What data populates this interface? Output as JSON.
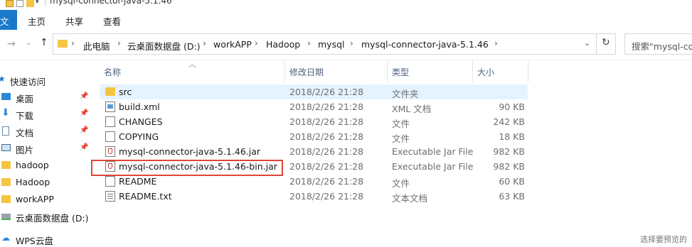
{
  "window": {
    "title": "mysql-connector-java-5.1.46"
  },
  "ribbon": {
    "tabs": [
      "文件",
      "主页",
      "共享",
      "查看"
    ]
  },
  "address": {
    "crumbs": [
      "此电脑",
      "云桌面数据盘 (D:)",
      "workAPP",
      "Hadoop",
      "mysql",
      "mysql-connector-java-5.1.46"
    ],
    "search_placeholder": "搜索\"mysql-con"
  },
  "sidebar": {
    "items": [
      {
        "label": "快速访问",
        "icon": "star-icon"
      },
      {
        "label": "桌面",
        "icon": "desktop-icon",
        "pinned": true
      },
      {
        "label": "下载",
        "icon": "download-icon",
        "pinned": true
      },
      {
        "label": "文档",
        "icon": "document-icon",
        "pinned": true
      },
      {
        "label": "图片",
        "icon": "picture-icon",
        "pinned": true
      },
      {
        "label": "hadoop",
        "icon": "folder-icon"
      },
      {
        "label": "Hadoop",
        "icon": "folder-icon"
      },
      {
        "label": "workAPP",
        "icon": "folder-icon"
      },
      {
        "label": "云桌面数据盘 (D:)",
        "icon": "drive-icon"
      },
      {
        "label": "WPS云盘",
        "icon": "cloud-icon"
      }
    ]
  },
  "columns": [
    "名称",
    "修改日期",
    "类型",
    "大小"
  ],
  "files": [
    {
      "name": "src",
      "date": "2018/2/26 21:28",
      "type": "文件夹",
      "size": "",
      "icon": "folder-icon",
      "selected": true
    },
    {
      "name": "build.xml",
      "date": "2018/2/26 21:28",
      "type": "XML 文档",
      "size": "90 KB",
      "icon": "xml-file-icon"
    },
    {
      "name": "CHANGES",
      "date": "2018/2/26 21:28",
      "type": "文件",
      "size": "242 KB",
      "icon": "file-icon"
    },
    {
      "name": "COPYING",
      "date": "2018/2/26 21:28",
      "type": "文件",
      "size": "18 KB",
      "icon": "file-icon"
    },
    {
      "name": "mysql-connector-java-5.1.46.jar",
      "date": "2018/2/26 21:28",
      "type": "Executable Jar File",
      "size": "982 KB",
      "icon": "jar-file-icon"
    },
    {
      "name": "mysql-connector-java-5.1.46-bin.jar",
      "date": "2018/2/26 21:28",
      "type": "Executable Jar File",
      "size": "982 KB",
      "icon": "jar-file-icon"
    },
    {
      "name": "README",
      "date": "2018/2/26 21:28",
      "type": "文件",
      "size": "60 KB",
      "icon": "file-icon"
    },
    {
      "name": "README.txt",
      "date": "2018/2/26 21:28",
      "type": "文本文档",
      "size": "63 KB",
      "icon": "text-file-icon"
    }
  ],
  "status": {
    "hint": "选择要预览的"
  },
  "colors": {
    "accent": "#1979ca",
    "selected_row": "#e5f3ff",
    "highlight_border": "#e0463a",
    "folder": "#f5c542"
  }
}
